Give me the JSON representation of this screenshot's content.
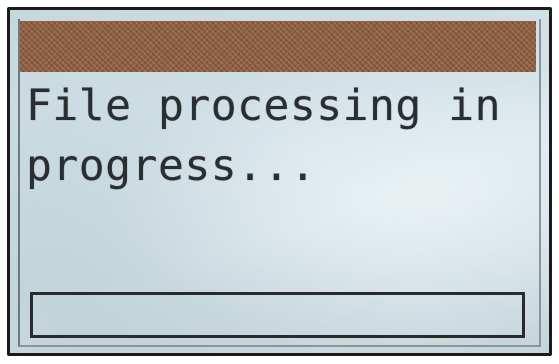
{
  "screen": {
    "title_bar_color": "#8a5a3e",
    "message": "File processing in progress..."
  },
  "progress": {
    "value_fraction": 0.0
  }
}
